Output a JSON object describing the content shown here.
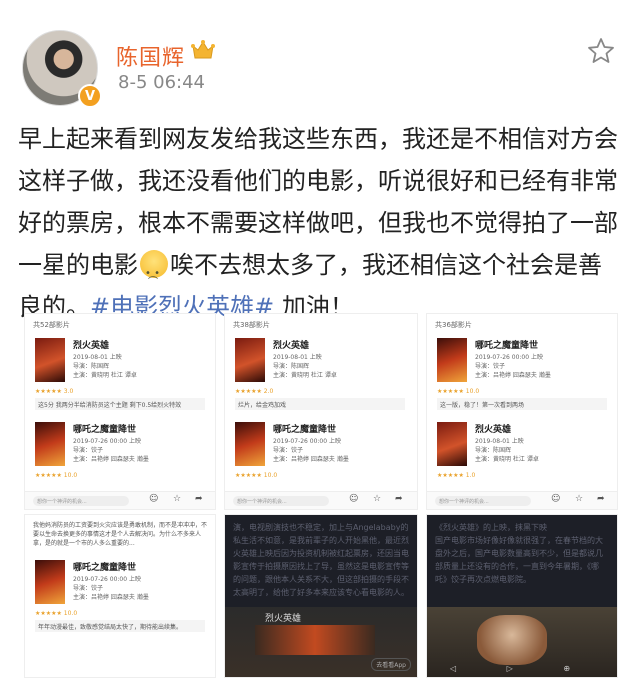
{
  "header": {
    "username": "陈国辉",
    "time": "8-5 06:44",
    "verified_badge": "V"
  },
  "post": {
    "text_before_emoji": "早上起来看到网友发给我这些东西，我还是不相信对方会这样子做，我还没看他们的电影，听说很好和已经有非常好的票房，根本不需要这样做吧，但我也不觉得拍了一部一星的电影",
    "text_after_emoji": "唉不去想太多了，我还相信这个社会是善良的。",
    "hashtag": "#电影烈火英雄#",
    "text_end": " 加油！",
    "emoji_name": "sad-emoji"
  },
  "screenshots": {
    "c1": {
      "count": "共52部影片",
      "movies": [
        {
          "title": "烈火英雄",
          "date": "2019-08-01 上映",
          "director": "导演：陈国辉",
          "cast": "主演：黄晓明 杜江 谭卓",
          "rating": "★★★★★ 3.0",
          "review": "这5分 我两分半给消防员这个主题 剩下0.5给烈火特效"
        },
        {
          "title": "哪吒之魔童降世",
          "date": "2019-07-26 00:00 上映",
          "director": "导演：饺子",
          "cast": "主演：吕艳婷 囧森瑟夫 瀚墨",
          "rating": "★★★★★ 10.0",
          "review": ""
        }
      ],
      "input_placeholder": "想你一个神评的机会..."
    },
    "c2": {
      "count": "共38部影片",
      "movies": [
        {
          "title": "烈火英雄",
          "date": "2019-08-01 上映",
          "director": "导演：陈国辉",
          "cast": "主演：黄晓明 杜江 谭卓",
          "rating": "★★★★★ 2.0",
          "review": "烂片，给金鸡加戏"
        },
        {
          "title": "哪吒之魔童降世",
          "date": "2019-07-26 00:00 上映",
          "director": "导演：饺子",
          "cast": "主演：吕艳婷 囧森瑟夫 瀚墨",
          "rating": "★★★★★ 10.0",
          "review": ""
        }
      ],
      "input_placeholder": "想你一个神评的机会..."
    },
    "c3": {
      "count": "共36部影片",
      "movies": [
        {
          "title": "哪吒之魔童降世",
          "date": "2019-07-26 00:00 上映",
          "director": "导演：饺子",
          "cast": "主演：吕艳婷 囧森瑟夫 瀚墨",
          "rating": "★★★★★ 10.0",
          "review": "这一版，稳了！第一次看到两场"
        },
        {
          "title": "烈火英雄",
          "date": "2019-08-01 上映",
          "director": "导演：陈国辉",
          "cast": "主演：黄晓明 杜江 谭卓",
          "rating": "★★★★★ 1.0",
          "review": ""
        }
      ],
      "input_placeholder": "想你一个神评的机会..."
    },
    "c4": {
      "review_top": "我他妈消防员的工资要到火灾应该是勇敢机制，而不是冲冲冲，不要以生命去换更多的事情这才是个人去解决问。为什么不多来人拿，是的就是一个市的人多么重要的...",
      "movie": {
        "title": "哪吒之魔童降世",
        "date": "2019-07-26 00:00 上映",
        "director": "导演：饺子",
        "cast": "主演：吕艳婷 囧森瑟夫 瀚墨",
        "rating": "★★★★★ 10.0",
        "review": "年年动漫最佳，致敬感觉结局太快了，期待能出续集。"
      }
    },
    "c5": {
      "text": "演，电视剧演技也不稳定，加上与Angelababy的私生活不如意，是我前辈子的人开始黑他，最近烈火英雄上映后因为投资机制被红起票房，还因当电影宣传于拍摄原因找上了导，虽然这是电影宣传等的问题，跟他本人关系不大，但这部拍摄的手段不太高明了，给他了好多本来应该专心看电影的人。",
      "film_title": "烈火英雄",
      "app_button": "去看看App"
    },
    "c6": {
      "text": "国产电影市场好像好像就很强了，在春节档的大盘外之后，国产电影数量高到不少，但是都说几部质量上还没有的合作，一直到今年暑期，《哪吒》饺子再次点燃电影院。",
      "top_text": "《烈火英雄》的上映，抹黑下映"
    }
  },
  "icons": {
    "star": "star-outline-icon",
    "crown": "crown-badge-icon"
  },
  "colors": {
    "username": "#e8642c",
    "hashtag": "#4f71b8"
  }
}
